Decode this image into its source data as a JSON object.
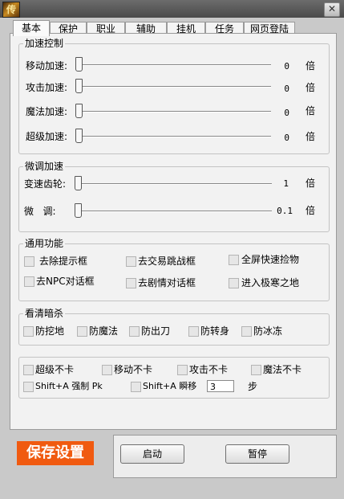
{
  "window": {
    "logo_glyph": "传",
    "close_glyph": "✕"
  },
  "tabs": [
    "基本",
    "保护",
    "职业",
    "辅助",
    "挂机",
    "任务",
    "网页登陆"
  ],
  "speed_group": {
    "title": "加速控制",
    "rows": [
      {
        "label": "移动加速:",
        "value": "0",
        "unit": "倍"
      },
      {
        "label": "攻击加速:",
        "value": "0",
        "unit": "倍"
      },
      {
        "label": "魔法加速:",
        "value": "0",
        "unit": "倍"
      },
      {
        "label": "超级加速:",
        "value": "0",
        "unit": "倍"
      }
    ]
  },
  "fine_group": {
    "title": "微调加速",
    "rows": [
      {
        "label": "变速齿轮:",
        "value": "1",
        "unit": "倍"
      },
      {
        "label": "微   调:",
        "value": "0.1",
        "unit": "倍"
      }
    ]
  },
  "general_group": {
    "title": "通用功能",
    "items": [
      "去除提示框",
      "去交易跳战框",
      "全屏快速捡物",
      "去NPC对话框",
      "去剧情对话框",
      "进入极寒之地"
    ]
  },
  "assassin_group": {
    "title": "看清暗杀",
    "items": [
      "防挖地",
      "防魔法",
      "防出刀",
      "防转身",
      "防冰冻"
    ]
  },
  "misc_group": {
    "items": [
      "超级不卡",
      "移动不卡",
      "攻击不卡",
      "魔法不卡",
      "Shift+A 强制 Pk",
      "Shift+A 瞬移"
    ],
    "step_value": "3",
    "step_unit": "步"
  },
  "buttons": {
    "save": "保存设置",
    "start": "启动",
    "pause": "暂停"
  }
}
